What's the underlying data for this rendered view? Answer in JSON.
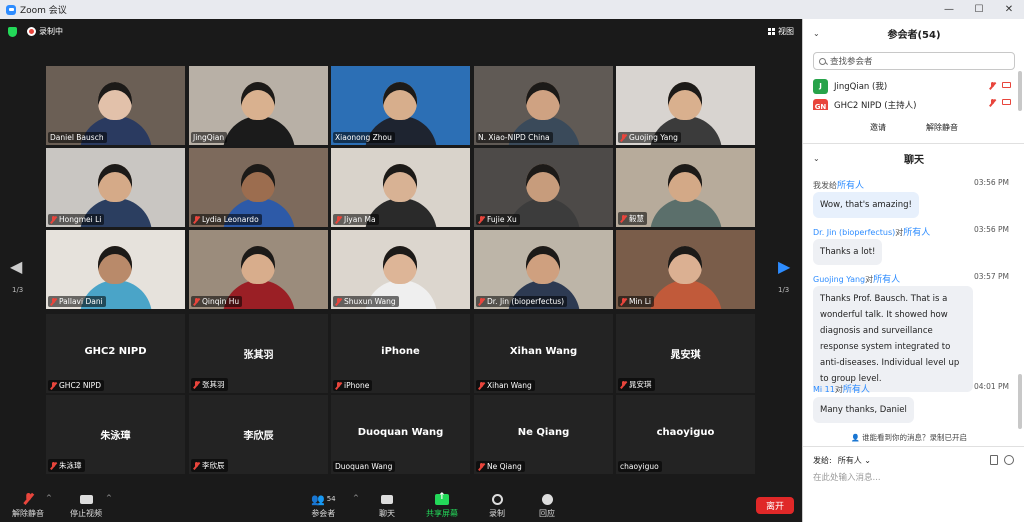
{
  "window": {
    "title": "Zoom 会议",
    "minimize": "—",
    "maximize": "☐",
    "close": "✕"
  },
  "topbar": {
    "recording": "录制中",
    "view": "视图"
  },
  "pager": {
    "left": "1/3",
    "right": "1/3"
  },
  "tiles": [
    {
      "name": "Daniel Bausch",
      "video": true,
      "muted": false,
      "bg": "#6b5f55",
      "skin": "#e2c1aa",
      "shirt": "#2a3a60"
    },
    {
      "name": "JingQian",
      "video": true,
      "muted": false,
      "bg": "#b8b0a6",
      "skin": "#d9b18f",
      "shirt": "#1b1b1b"
    },
    {
      "name": "Xiaonong Zhou",
      "video": true,
      "muted": false,
      "bg": "#2c6fb5",
      "skin": "#d7ae8c",
      "shirt": "#1e2430",
      "active": true
    },
    {
      "name": "N. Xiao-NIPD China",
      "video": true,
      "muted": false,
      "bg": "#605a55",
      "skin": "#cfa282",
      "shirt": "#3a4a5a"
    },
    {
      "name": "Guojing Yang",
      "video": true,
      "muted": true,
      "bg": "#d8d4d0",
      "skin": "#d9b08e",
      "shirt": "#3b3b3b"
    },
    {
      "name": "Hongmei Li",
      "video": true,
      "muted": true,
      "bg": "#c9c6c2",
      "skin": "#d5aa88",
      "shirt": "#2b3e60"
    },
    {
      "name": "Lydia Leonardo",
      "video": true,
      "muted": true,
      "bg": "#7d6a5c",
      "skin": "#9c6d4f",
      "shirt": "#2d5aa8"
    },
    {
      "name": "Jiyan Ma",
      "video": true,
      "muted": true,
      "bg": "#d9d3cb",
      "skin": "#d8b294",
      "shirt": "#2a2a2a"
    },
    {
      "name": "Fujie Xu",
      "video": true,
      "muted": true,
      "bg": "#4d4a48",
      "skin": "#c79c7c",
      "shirt": "#3c3c3c"
    },
    {
      "name": "毅慧",
      "video": true,
      "muted": true,
      "bg": "#b7ab9b",
      "skin": "#d3a987",
      "shirt": "#5b6f6b"
    },
    {
      "name": "Pallavi Dani",
      "video": true,
      "muted": true,
      "bg": "#e6e2dc",
      "skin": "#b98a6a",
      "shirt": "#4aa4c8"
    },
    {
      "name": "Qinqin Hu",
      "video": true,
      "muted": true,
      "bg": "#9b8c7c",
      "skin": "#d8ad8c",
      "shirt": "#9a1f25"
    },
    {
      "name": "Shuxun Wang",
      "video": true,
      "muted": true,
      "bg": "#dcd6ce",
      "skin": "#ddb597",
      "shirt": "#efefef"
    },
    {
      "name": "Dr. Jin (bioperfectus)",
      "video": true,
      "muted": true,
      "bg": "#bdb5a8",
      "skin": "#cfa07f",
      "shirt": "#2d3a52"
    },
    {
      "name": "Min Li",
      "video": true,
      "muted": true,
      "bg": "#7a5d4a",
      "skin": "#dbb092",
      "shirt": "#c15a3a"
    },
    {
      "name": "GHC2 NIPD",
      "video": false,
      "muted": true
    },
    {
      "name": "张其羽",
      "video": false,
      "muted": true
    },
    {
      "name": "iPhone",
      "video": false,
      "muted": true
    },
    {
      "name": "Xihan Wang",
      "video": false,
      "muted": true
    },
    {
      "name": "晁安琪",
      "video": false,
      "muted": true
    },
    {
      "name": "朱泳璋",
      "video": false,
      "muted": true
    },
    {
      "name": "李欣辰",
      "video": false,
      "muted": true
    },
    {
      "name": "Duoquan Wang",
      "video": false,
      "muted": false
    },
    {
      "name": "Ne Qiang",
      "video": false,
      "muted": true
    },
    {
      "name": "chaoyiguo",
      "video": false,
      "muted": false
    }
  ],
  "toolbar": {
    "unmute": "解除静音",
    "stop_video": "停止视频",
    "participants": "参会者",
    "participants_count": "54",
    "chat": "聊天",
    "share": "共享屏幕",
    "record": "录制",
    "reactions": "回应",
    "leave": "离开"
  },
  "participants_panel": {
    "title": "参会者(54)",
    "search_placeholder": "查找参会者",
    "rows": [
      {
        "avatar": "J",
        "name": "JingQian (我)",
        "color": "#27a34a"
      },
      {
        "avatar": "GN",
        "name": "GHC2 NIPD (主持人)",
        "color": "#e8453c"
      }
    ],
    "invite": "邀请",
    "unmute_all": "解除静音"
  },
  "chat_panel": {
    "title": "聊天",
    "messages": [
      {
        "from": "",
        "prefix": "我发给",
        "to": "所有人",
        "time": "03:56 PM",
        "text": "Wow, that's amazing!",
        "mine": true
      },
      {
        "from": "Dr. Jin (bioperfectus)",
        "prefix": "对",
        "to": "所有人",
        "time": "03:56 PM",
        "text": "Thanks a lot!",
        "mine": false
      },
      {
        "from": "Guojing Yang",
        "prefix": "对",
        "to": "所有人",
        "time": "03:57 PM",
        "text": "Thanks Prof. Bausch. That is a wonderful talk. It showed how diagnosis and surveillance response system integrated to anti-diseases. Individual level up to group level.",
        "mine": false
      },
      {
        "from": "Mi 11",
        "prefix": "对",
        "to": "所有人",
        "time": "04:01 PM",
        "text": "Many thanks, Daniel",
        "mine": false
      }
    ],
    "notice": "谁能看到你的消息？录制已开启",
    "send_to_label": "发给:",
    "send_to_value": "所有人 ⌄",
    "input_placeholder": "在此处输入消息..."
  }
}
